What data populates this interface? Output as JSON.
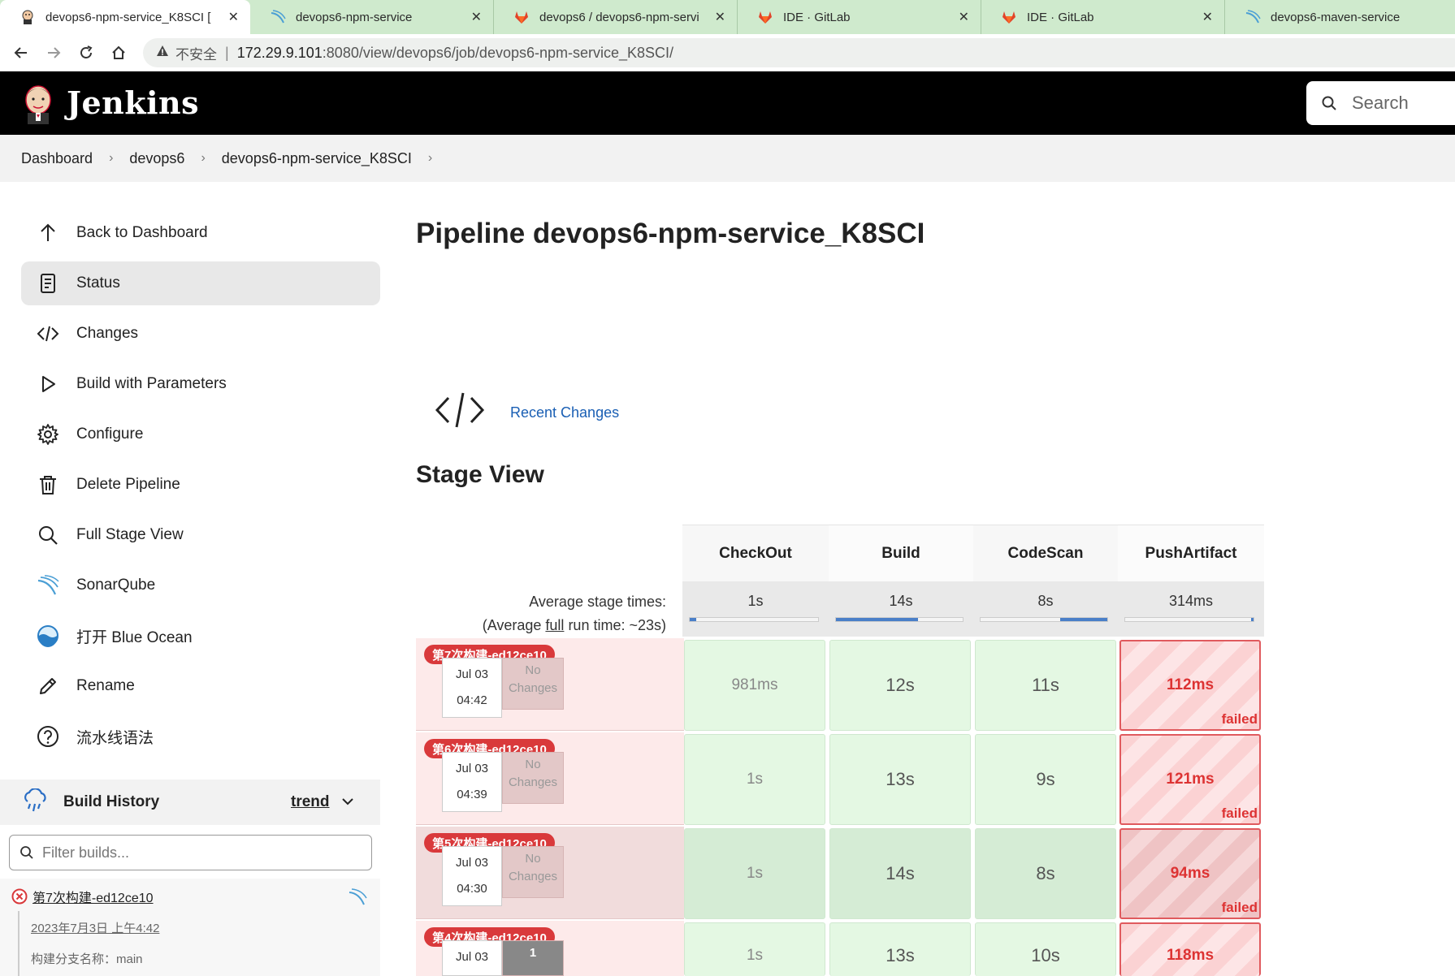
{
  "browser": {
    "tabs": [
      {
        "title": "devops6-npm-service_K8SCI [",
        "icon": "jenkins-icon",
        "active": true
      },
      {
        "title": "devops6-npm-service",
        "icon": "sonarqube-icon",
        "active": false
      },
      {
        "title": "devops6 / devops6-npm-servi",
        "icon": "gitlab-icon",
        "active": false
      },
      {
        "title": "IDE · GitLab",
        "icon": "gitlab-icon",
        "active": false
      },
      {
        "title": "IDE · GitLab",
        "icon": "gitlab-icon",
        "active": false
      },
      {
        "title": "devops6-maven-service",
        "icon": "sonarqube-icon",
        "active": false
      }
    ],
    "close_glyph": "✕",
    "address": {
      "insecure_label": "不安全",
      "host": "172.29.9.101",
      "path": ":8080/view/devops6/job/devops6-npm-service_K8SCI/"
    }
  },
  "header": {
    "brand": "Jenkins",
    "search_placeholder": "Search"
  },
  "breadcrumb": [
    "Dashboard",
    "devops6",
    "devops6-npm-service_K8SCI"
  ],
  "sidebar": {
    "items": [
      {
        "label": "Back to Dashboard",
        "icon": "arrow-up-icon"
      },
      {
        "label": "Status",
        "icon": "document-icon",
        "active": true
      },
      {
        "label": "Changes",
        "icon": "code-icon"
      },
      {
        "label": "Build with Parameters",
        "icon": "play-icon"
      },
      {
        "label": "Configure",
        "icon": "gear-icon"
      },
      {
        "label": "Delete Pipeline",
        "icon": "trash-icon"
      },
      {
        "label": "Full Stage View",
        "icon": "search-icon"
      },
      {
        "label": "SonarQube",
        "icon": "sonarqube-icon"
      },
      {
        "label": "打开 Blue Ocean",
        "icon": "blue-ocean-icon"
      },
      {
        "label": "Rename",
        "icon": "pencil-icon"
      },
      {
        "label": "流水线语法",
        "icon": "help-icon"
      }
    ]
  },
  "build_history": {
    "title": "Build History",
    "trend": "trend",
    "filter_placeholder": "Filter builds...",
    "latest": {
      "name": "第7次构建-ed12ce10",
      "date": "2023年7月3日 上午4:42",
      "branch": "构建分支名称：main"
    }
  },
  "main": {
    "title": "Pipeline devops6-npm-service_K8SCI",
    "recent_changes": "Recent Changes",
    "stage_view_title": "Stage View"
  },
  "stage_view": {
    "avg_label_1": "Average stage times:",
    "avg_label_2a": "(Average ",
    "avg_label_2b": "full",
    "avg_label_2c": " run time: ~23s)",
    "stages": [
      {
        "name": "CheckOut",
        "avg": "1s",
        "avg_fraction": 0.05
      },
      {
        "name": "Build",
        "avg": "14s",
        "avg_fraction": 0.65
      },
      {
        "name": "CodeScan",
        "avg": "8s",
        "avg_fraction": 0.37
      },
      {
        "name": "PushArtifact",
        "avg": "314ms",
        "avg_fraction": 0.02
      }
    ],
    "builds": [
      {
        "badge": "第7次构建-ed12ce10",
        "date": "Jul 03",
        "time": "04:42",
        "changes": "No Changes",
        "cells": [
          "981ms",
          "12s",
          "11s",
          "112ms"
        ]
      },
      {
        "badge": "第6次构建-ed12ce10",
        "date": "Jul 03",
        "time": "04:39",
        "changes": "No Changes",
        "cells": [
          "1s",
          "13s",
          "9s",
          "121ms"
        ]
      },
      {
        "badge": "第5次构建-ed12ce10",
        "date": "Jul 03",
        "time": "04:30",
        "changes": "No Changes",
        "cells": [
          "1s",
          "14s",
          "8s",
          "94ms"
        ]
      },
      {
        "badge": "第4次构建-ed12ce10",
        "date": "Jul 03",
        "time": "",
        "changes": "1",
        "cells": [
          "1s",
          "13s",
          "10s",
          "118ms"
        ]
      }
    ],
    "failed_label": "failed"
  },
  "colors": {
    "accent_link": "#1a5fb4",
    "failed_red": "#d9393b",
    "success_green": "#e4f8e3"
  }
}
